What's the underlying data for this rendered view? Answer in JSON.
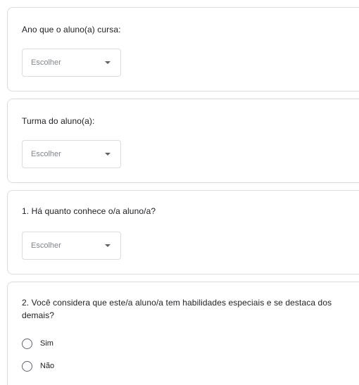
{
  "questions": [
    {
      "title": "Ano que o aluno(a) cursa:",
      "dropdown": {
        "selected": "Escolher",
        "icon": "caret-down-icon"
      }
    },
    {
      "title": "Turma do aluno(a):",
      "dropdown": {
        "selected": "Escolher",
        "icon": "caret-down-icon"
      }
    },
    {
      "title": "1. Há quanto conhece o/a aluno/a?",
      "dropdown": {
        "selected": "Escolher",
        "icon": "caret-down-icon"
      }
    },
    {
      "title_line1": "2. Você considera que este/a aluno/a tem habilidades especiais e se destaca dos",
      "title_line2": "demais?",
      "options": [
        "Sim",
        "Não"
      ]
    }
  ],
  "colors": {
    "border": "#dadce0",
    "text": "#202124",
    "placeholder": "#80868b",
    "icon": "#5f6368"
  }
}
